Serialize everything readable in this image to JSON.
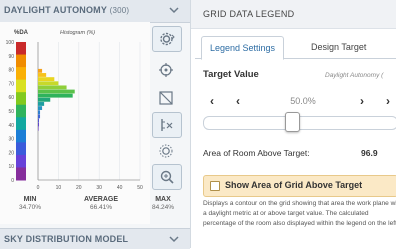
{
  "left_panel": {
    "title": "DAYLIGHT AUTONOMY",
    "title_sub": "(300)",
    "y_axis_label": "%DA",
    "histogram_label": "Histogram (%)",
    "footer_title": "SKY DISTRIBUTION MODEL",
    "stats": {
      "min_label": "MIN",
      "min_value": "34.70%",
      "avg_label": "AVERAGE",
      "avg_value": "66.41%",
      "max_label": "MAX",
      "max_value": "84.24%"
    },
    "tools": [
      "gear-icon",
      "crosshair-icon",
      "diagonal-box-icon",
      "scale-icon",
      "sun-icon",
      "zoom-icon"
    ]
  },
  "chart_data": {
    "type": "bar",
    "orientation": "horizontal",
    "y_axis": {
      "label": "%DA",
      "ticks": [
        "100",
        "90",
        "80",
        "70",
        "60",
        "50",
        "40",
        "30",
        "20",
        "10",
        "0"
      ],
      "range": [
        0,
        100
      ]
    },
    "x_axis": {
      "label": "Histogram (%)",
      "ticks": [
        "0",
        "10",
        "20",
        "30",
        "40",
        "50"
      ],
      "range": [
        0,
        50
      ]
    },
    "bins": [
      {
        "da": 79,
        "value": 2,
        "color": "#f4a11d"
      },
      {
        "da": 76,
        "value": 4,
        "color": "#f7c21a"
      },
      {
        "da": 73,
        "value": 8,
        "color": "#e8d520"
      },
      {
        "da": 70,
        "value": 10,
        "color": "#c7d92a"
      },
      {
        "da": 67,
        "value": 14,
        "color": "#8fcf3a"
      },
      {
        "da": 64,
        "value": 18,
        "color": "#5bc14a"
      },
      {
        "da": 61,
        "value": 17,
        "color": "#2fb35c"
      },
      {
        "da": 58,
        "value": 6,
        "color": "#22a67a"
      },
      {
        "da": 55,
        "value": 3,
        "color": "#1e9ea0"
      },
      {
        "da": 52,
        "value": 2,
        "color": "#2693c0"
      },
      {
        "da": 49,
        "value": 1,
        "color": "#2f7fd0"
      },
      {
        "da": 46,
        "value": 1,
        "color": "#3f66d3"
      },
      {
        "da": 43,
        "value": 0.5,
        "color": "#5053cf"
      },
      {
        "da": 40,
        "value": 0.5,
        "color": "#6147c9"
      },
      {
        "da": 37,
        "value": 0.3,
        "color": "#6e3ec2"
      }
    ],
    "color_scale": [
      "#c92a2a",
      "#f08c00",
      "#fab005",
      "#d9e021",
      "#82c91e",
      "#2fb35c",
      "#12a8a0",
      "#1c7ed6",
      "#3b5bdb",
      "#6741d9",
      "#862e9c"
    ]
  },
  "right_panel": {
    "title": "GRID DATA LEGEND",
    "tabs": {
      "legend_settings": "Legend Settings",
      "design_target": "Design Target"
    },
    "target_value_label": "Target Value",
    "target_hint": "Daylight Autonomy (",
    "target_value": "50.0%",
    "slider_value": 0.5,
    "area_label": "Area of Room Above Target:",
    "area_value": "96.9",
    "show_button_label": "Show Area of Grid Above Target",
    "description": "Displays a contour on the grid showing that area the work plane with a daylight metric at or above target value. The calculated percentage of the room also displayed within the legend on the left."
  }
}
